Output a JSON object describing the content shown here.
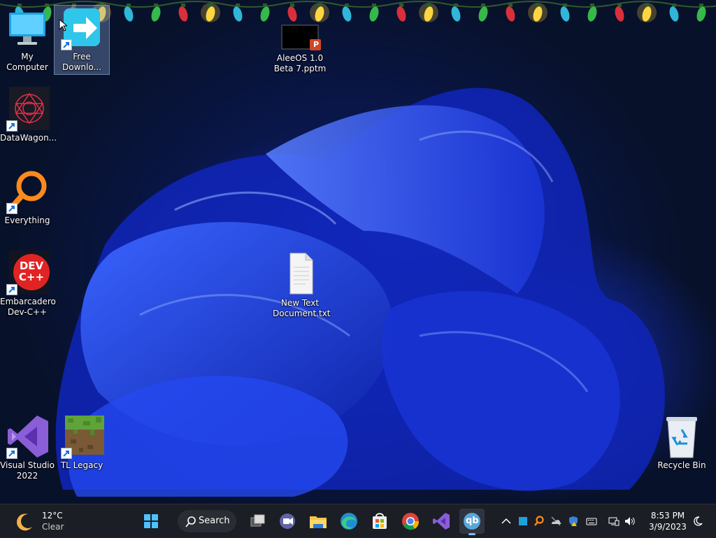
{
  "desktop": {
    "icons": [
      {
        "label": "My Computer"
      },
      {
        "label": "Free Downlo..."
      },
      {
        "label": "AleeOS 1.0 Beta 7.pptm"
      },
      {
        "label": "DataWagon..."
      },
      {
        "label": "Everything"
      },
      {
        "label": "Embarcadero Dev-C++"
      },
      {
        "label": "New Text Document.txt"
      },
      {
        "label": "Visual Studio 2022"
      },
      {
        "label": "TL Legacy"
      },
      {
        "label": "Recycle Bin"
      }
    ],
    "icon_text": {
      "ppt": "P",
      "dev_line1": "DEV",
      "dev_line2": "C++"
    }
  },
  "taskbar": {
    "weather": {
      "temp": "12°C",
      "condition": "Clear"
    },
    "search_label": "Search",
    "clock": {
      "time": "8:53 PM",
      "date": "3/9/2023"
    },
    "pinned": [
      "start-button",
      "search",
      "task-view",
      "chat",
      "file-explorer",
      "edge",
      "store",
      "chrome",
      "visual-studio",
      "qb"
    ],
    "qb_label": "qb"
  }
}
